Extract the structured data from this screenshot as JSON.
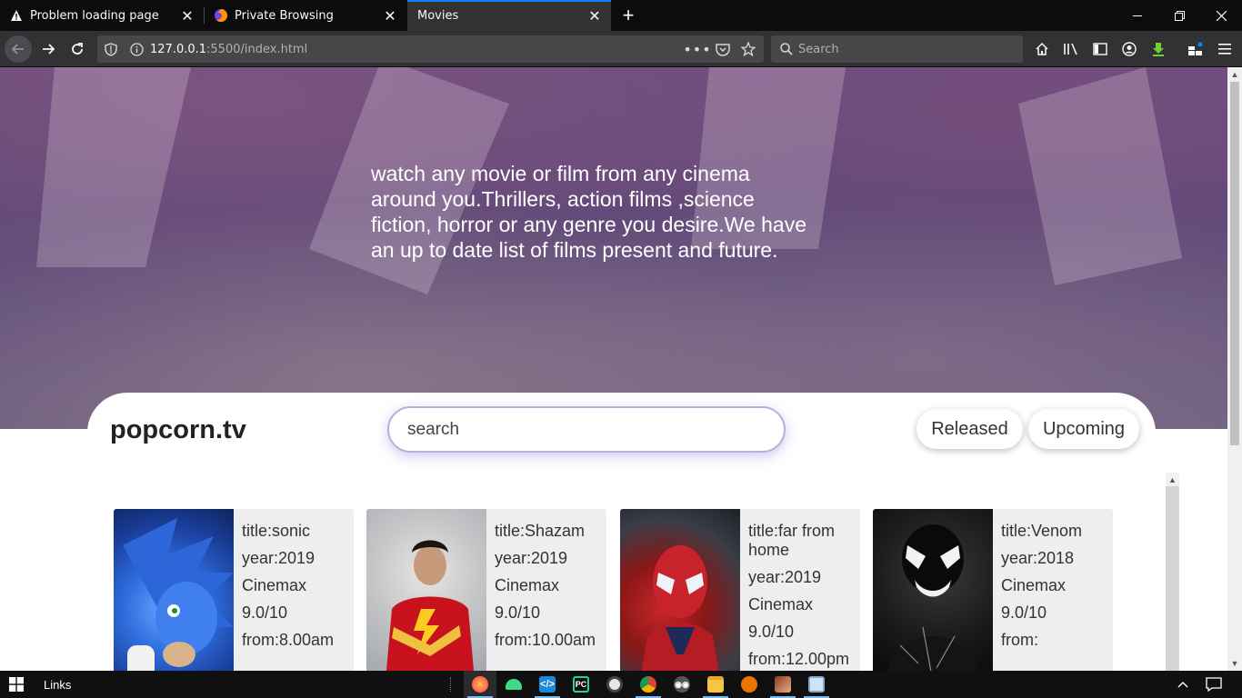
{
  "browser": {
    "tabs": [
      {
        "title": "Problem loading page",
        "icon": "warning-icon",
        "active": false
      },
      {
        "title": "Private Browsing",
        "icon": "firefox-icon",
        "active": false
      },
      {
        "title": "Movies",
        "icon": "none",
        "active": true
      }
    ],
    "url": {
      "host": "127.0.0.1",
      "rest": ":5500/index.html"
    },
    "search_placeholder": "Search"
  },
  "page": {
    "hero_text": "watch any movie or film from any cinema around you.Thrillers, action films ,science fiction, horror or any genre you desire.We have an up to date list of films present and future.",
    "brand": "popcorn.tv",
    "search_placeholder": "search",
    "filters": {
      "released": "Released",
      "upcoming": "Upcoming"
    },
    "movies": [
      {
        "title": "title:sonic",
        "year": "year:2019",
        "cinema": "Cinemax",
        "rating": "9.0/10",
        "time": "from:8.00am"
      },
      {
        "title": "title:Shazam",
        "year": "year:2019",
        "cinema": "Cinemax",
        "rating": "9.0/10",
        "time": "from:10.00am"
      },
      {
        "title": "title:far from home",
        "year": "year:2019",
        "cinema": "Cinemax",
        "rating": "9.0/10",
        "time": "from:12.00pm"
      },
      {
        "title": "title:Venom",
        "year": "year:2018",
        "cinema": "Cinemax",
        "rating": "9.0/10",
        "time": "from:"
      }
    ]
  },
  "taskbar": {
    "links_label": "Links"
  },
  "colors": {
    "accent": "#0a84ff",
    "hero_overlay": "#46327a"
  }
}
